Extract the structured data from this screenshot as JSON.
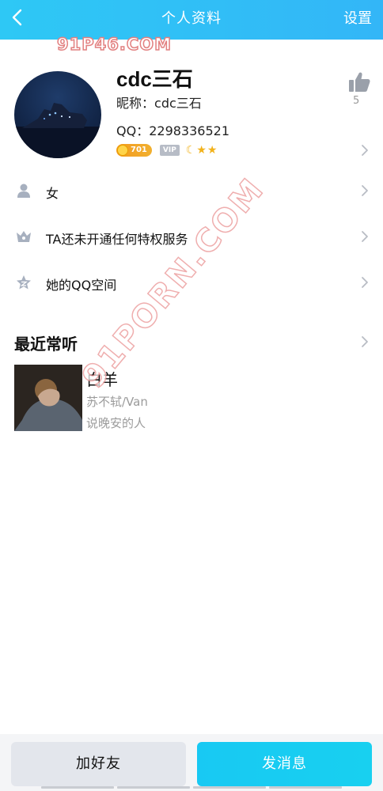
{
  "header": {
    "title": "个人资料",
    "settings_label": "设置",
    "back_icon": "chevron-left-icon"
  },
  "watermark": {
    "top": "91P46.COM",
    "diagonal": "91PORN.COM"
  },
  "profile": {
    "display_name": "cdc三石",
    "nickname_label": "昵称：",
    "nickname_value": "cdc三石",
    "qq_label": "QQ：",
    "qq_number": "2298336521",
    "level_badge": "701",
    "vip_badge": "VIP",
    "like_count": "5"
  },
  "info_rows": [
    {
      "icon": "person-icon",
      "text": "女"
    },
    {
      "icon": "crown-icon",
      "text": "TA还未开通任何特权服务"
    },
    {
      "icon": "star-icon",
      "text": "她的QQ空间"
    }
  ],
  "recent": {
    "section_title": "最近常听",
    "song_title": "白羊",
    "artist": "苏不轼/Van",
    "album": "说晚安的人"
  },
  "bottom": {
    "add_friend_label": "加好友",
    "send_message_label": "发消息"
  },
  "colors": {
    "header": "#2ec8f5",
    "primary_button": "#18c9f3",
    "secondary_button": "#e3e6ec",
    "level_badge": "#f39a1f"
  }
}
